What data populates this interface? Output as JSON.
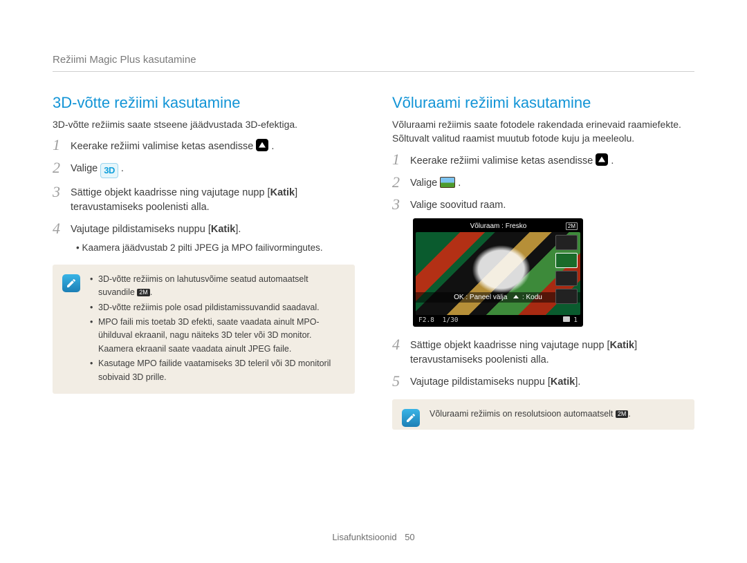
{
  "breadcrumb": "Režiimi Magic Plus kasutamine",
  "left": {
    "title": "3D-võtte režiimi kasutamine",
    "intro": "3D-võtte režiimis saate stseene jäädvustada 3D-efektiga.",
    "steps": {
      "s1_a": "Keerake režiimi valimise ketas asendisse",
      "s1_b": ".",
      "s2_a": "Valige",
      "s2_b": ".",
      "s3_a": "Sättige objekt kaadrisse ning vajutage nupp [",
      "s3_bold": "Katik",
      "s3_b": "] teravustamiseks poolenisti alla.",
      "s4_a": "Vajutage pildistamiseks nuppu [",
      "s4_bold": "Katik",
      "s4_b": "]."
    },
    "sub": "Kaamera jäädvustab 2 pilti JPEG ja MPO failivormingutes.",
    "notes": {
      "n1a": "3D-võtte režiimis on lahutusvõime seatud automaatselt suvandile ",
      "n1b": ".",
      "n2": "3D-võtte režiimis pole osad pildistamissuvandid saadaval.",
      "n3": "MPO faili mis toetab 3D efekti, saate vaadata ainult MPO-ühilduval ekraanil, nagu näiteks 3D teler või 3D monitor. Kaamera ekraanil saate vaadata ainult JPEG faile.",
      "n4": "Kasutage MPO failide vaatamiseks 3D teleril või 3D monitoril sobivaid 3D prille."
    }
  },
  "right": {
    "title": "Võluraami režiimi kasutamine",
    "intro": "Võluraami režiimis saate fotodele rakendada erinevaid raamiefekte. Sõltuvalt valitud raamist muutub fotode kuju ja meeleolu.",
    "steps": {
      "s1_a": "Keerake režiimi valimise ketas asendisse",
      "s1_b": ".",
      "s2_a": "Valige",
      "s2_b": ".",
      "s3": "Valige soovitud raam.",
      "s4_a": "Sättige objekt kaadrisse ning vajutage nupp [",
      "s4_bold": "Katik",
      "s4_b": "] teravustamiseks poolenisti alla.",
      "s5_a": "Vajutage pildistamiseks nuppu [",
      "s5_bold": "Katik",
      "s5_b": "]."
    },
    "camera": {
      "title": "Võluraam : Fresko",
      "res_badge": "2M",
      "status_a": "OK : Paneel välja",
      "status_b": ": Kodu",
      "f": "F2.8",
      "shutter": "1/30",
      "count": "1"
    },
    "note_a": "Võluraami režiimis on resolutsioon automaatselt ",
    "note_b": "."
  },
  "icons": {
    "three_d": "3D",
    "res_small": "2M"
  },
  "footer": {
    "section": "Lisafunktsioonid",
    "page": "50"
  }
}
